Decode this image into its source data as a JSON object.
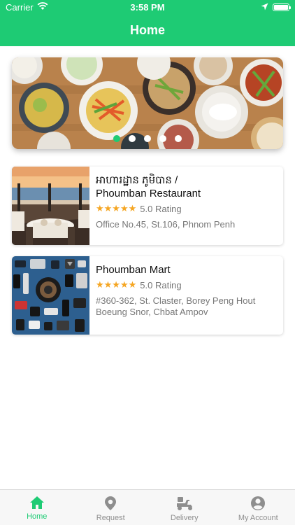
{
  "status_bar": {
    "carrier": "Carrier",
    "time": "3:58 PM",
    "battery_percent": 100
  },
  "header": {
    "title": "Home"
  },
  "banner": {
    "page_count": 5,
    "active_index": 0
  },
  "stores": [
    {
      "name": "អាហារដ្ឋាន ភូមិបាន /\nPhoumban Restaurant",
      "rating_text": "5.0 Rating",
      "stars": "★★★★★",
      "address": "Office No.45, St.106, Phnom Penh"
    },
    {
      "name": "Phoumban Mart",
      "rating_text": "5.0 Rating",
      "stars": "★★★★★",
      "address": "#360-362, St. Claster, Borey Peng Hout Boeung Snor, Chbat Ampov"
    }
  ],
  "tabs": [
    {
      "label": "Home",
      "icon": "home-icon",
      "active": true
    },
    {
      "label": "Request",
      "icon": "map-pin-icon",
      "active": false
    },
    {
      "label": "Delivery",
      "icon": "scooter-icon",
      "active": false
    },
    {
      "label": "My Account",
      "icon": "account-icon",
      "active": false
    }
  ],
  "colors": {
    "accent": "#1ecb74",
    "star": "#f5a623",
    "inactive": "#8e8e8e"
  }
}
